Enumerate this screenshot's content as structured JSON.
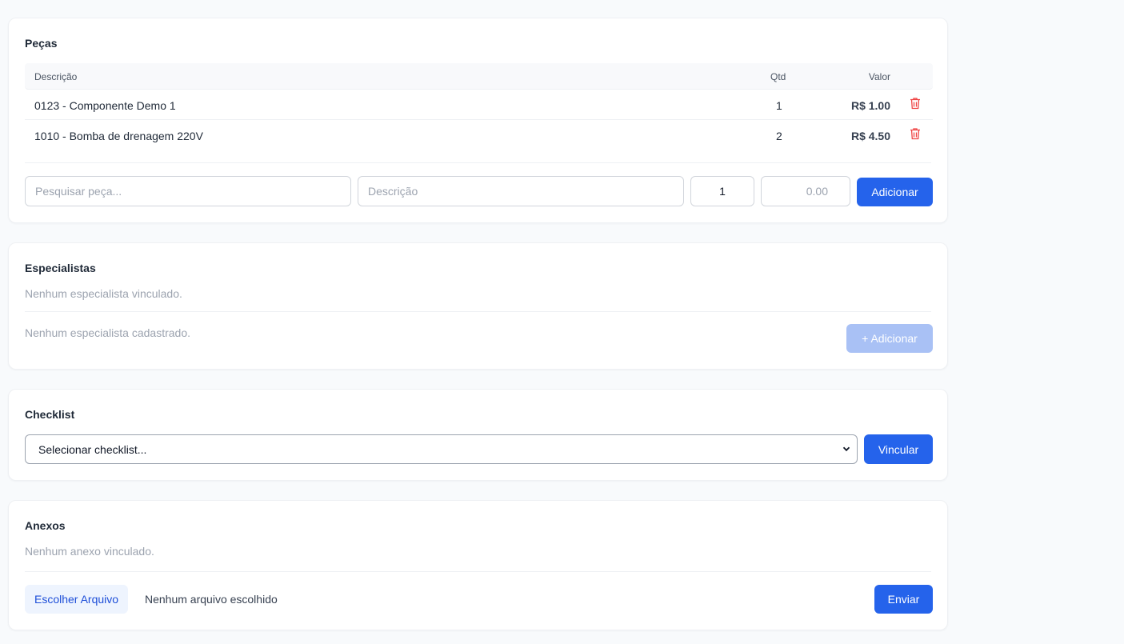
{
  "pecas": {
    "title": "Peças",
    "columns": {
      "descricao": "Descrição",
      "qtd": "Qtd",
      "valor": "Valor"
    },
    "rows": [
      {
        "descricao": "0123 - Componente Demo 1",
        "qtd": "1",
        "valor": "R$ 1.00"
      },
      {
        "descricao": "1010 - Bomba de drenagem 220V",
        "qtd": "2",
        "valor": "R$ 4.50"
      }
    ],
    "search_placeholder": "Pesquisar peça...",
    "desc_placeholder": "Descrição",
    "qty_value": "1",
    "price_placeholder": "0.00",
    "add_label": "Adicionar"
  },
  "especialistas": {
    "title": "Especialistas",
    "empty_linked": "Nenhum especialista vinculado.",
    "empty_registered": "Nenhum especialista cadastrado.",
    "add_label": "+ Adicionar"
  },
  "checklist": {
    "title": "Checklist",
    "select_value": "Selecionar checklist...",
    "link_label": "Vincular"
  },
  "anexos": {
    "title": "Anexos",
    "empty": "Nenhum anexo vinculado.",
    "choose_file_label": "Escolher Arquivo",
    "no_file": "Nenhum arquivo escolhido",
    "upload_label": "Enviar"
  },
  "icons": {
    "trash": "trash-icon",
    "chevron": "chevron-down-icon"
  },
  "colors": {
    "primary": "#2563eb",
    "primary_disabled": "#a9c1f5",
    "danger": "#ef4444",
    "muted": "#9ca3af"
  }
}
